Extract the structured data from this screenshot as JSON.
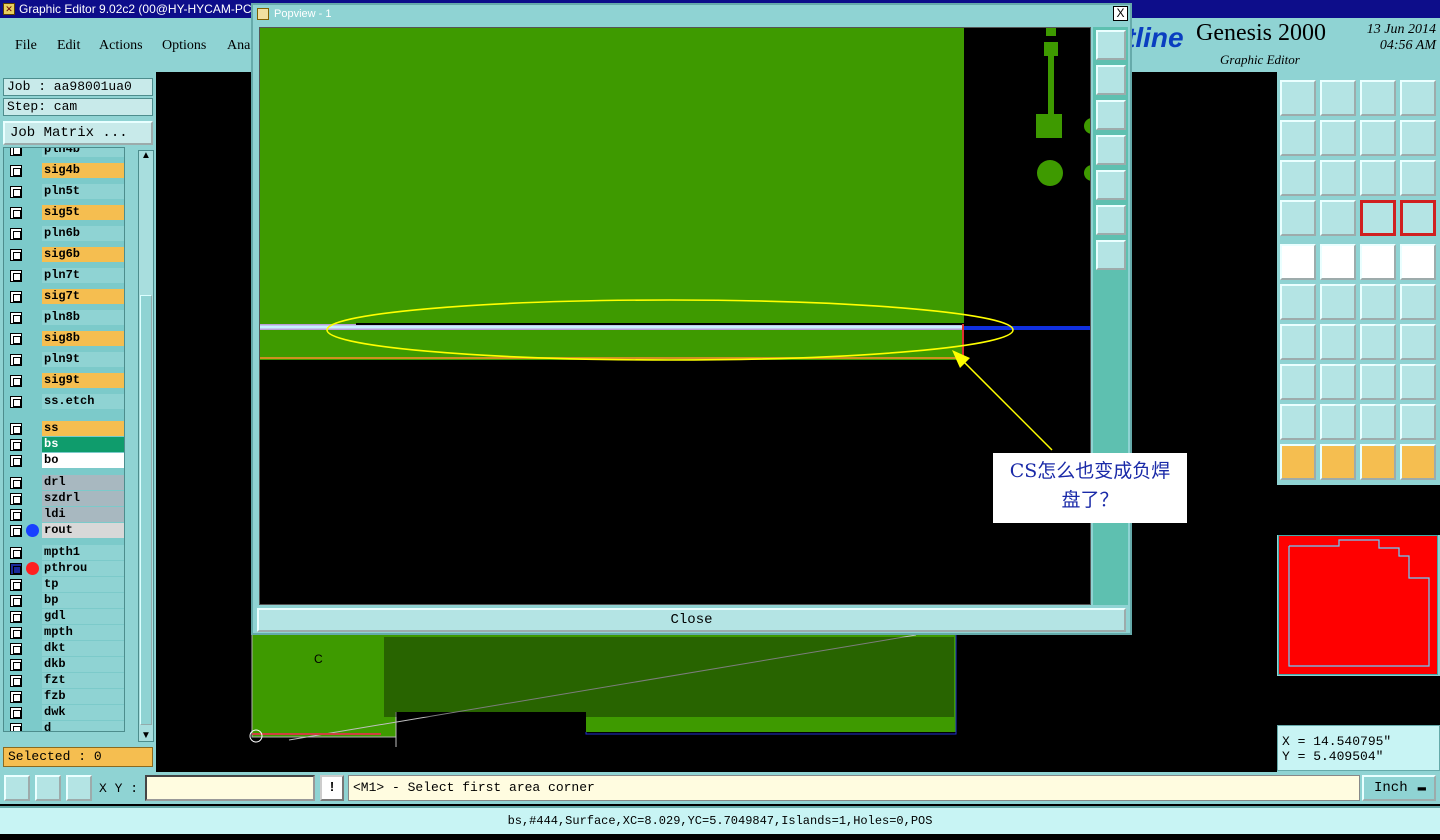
{
  "titlebar": {
    "title": "Graphic Editor 9.02c2 (00@HY-HYCAM-PC"
  },
  "menu": {
    "file": "File",
    "edit": "Edit",
    "actions": "Actions",
    "options": "Options",
    "analysis": "Ana"
  },
  "brand": {
    "logo": "tline",
    "product": "Genesis 2000",
    "sub": "Graphic Editor",
    "date": "13 Jun 2014",
    "time": "04:56 AM"
  },
  "job": {
    "job_label": "Job : aa98001ua0",
    "step_label": "Step: cam",
    "matrix_button": "Job Matrix ..."
  },
  "layers": [
    {
      "name": "pln4b",
      "color": "#8fd3d3"
    },
    {
      "name": "sig4b",
      "color": "#f5be50"
    },
    {
      "name": "pln5t",
      "color": "#8fd3d3"
    },
    {
      "name": "sig5t",
      "color": "#f5be50"
    },
    {
      "name": "pln6b",
      "color": "#8fd3d3"
    },
    {
      "name": "sig6b",
      "color": "#f5be50"
    },
    {
      "name": "pln7t",
      "color": "#8fd3d3"
    },
    {
      "name": "sig7t",
      "color": "#f5be50"
    },
    {
      "name": "pln8b",
      "color": "#8fd3d3"
    },
    {
      "name": "sig8b",
      "color": "#f5be50"
    },
    {
      "name": "pln9t",
      "color": "#8fd3d3"
    },
    {
      "name": "sig9t",
      "color": "#f5be50"
    },
    {
      "name": "ss.etch",
      "color": "#8fd3d3"
    },
    {
      "name": "ss",
      "color": "#f5be50"
    },
    {
      "name": "bs",
      "color": "#0f9c6c"
    },
    {
      "name": "bo",
      "color": "#ffffff"
    },
    {
      "name": "drl",
      "color": "#a8b8c0"
    },
    {
      "name": "szdrl",
      "color": "#a8b8c0"
    },
    {
      "name": "ldi",
      "color": "#a8b8c0"
    },
    {
      "name": "rout",
      "color": "#d8d8d8"
    },
    {
      "name": "mpth1",
      "color": "#8fd3d3"
    },
    {
      "name": "pthrou",
      "color": "#8fd3d3"
    },
    {
      "name": "tp",
      "color": "#8fd3d3"
    },
    {
      "name": "bp",
      "color": "#8fd3d3"
    },
    {
      "name": "gdl",
      "color": "#8fd3d3"
    },
    {
      "name": "mpth",
      "color": "#8fd3d3"
    },
    {
      "name": "dkt",
      "color": "#8fd3d3"
    },
    {
      "name": "dkb",
      "color": "#8fd3d3"
    },
    {
      "name": "fzt",
      "color": "#8fd3d3"
    },
    {
      "name": "fzb",
      "color": "#8fd3d3"
    },
    {
      "name": "dwk",
      "color": "#8fd3d3"
    },
    {
      "name": "d",
      "color": "#8fd3d3"
    }
  ],
  "selected": "Selected : 0",
  "popview": {
    "title": "Popview - 1",
    "close_x": "X",
    "close_button": "Close"
  },
  "callout": {
    "line1": "CS怎么也变成负焊",
    "line2": "盘了？"
  },
  "command": {
    "xy_label": "X Y :",
    "xy_value": "",
    "bang": "!",
    "prompt": "<M1> - Select first area corner",
    "units": "Inch"
  },
  "coords": {
    "x": "X = 14.540795\"",
    "y": "Y = 5.409504\""
  },
  "status": "bs,#444,Surface,XC=8.029,YC=5.7049847,Islands=1,Holes=0,POS",
  "colors": {
    "panel": "#8fd3d3",
    "board_green": "#3e9a00",
    "highlight": "#ffff00",
    "thumb_red": "#ff0000"
  }
}
